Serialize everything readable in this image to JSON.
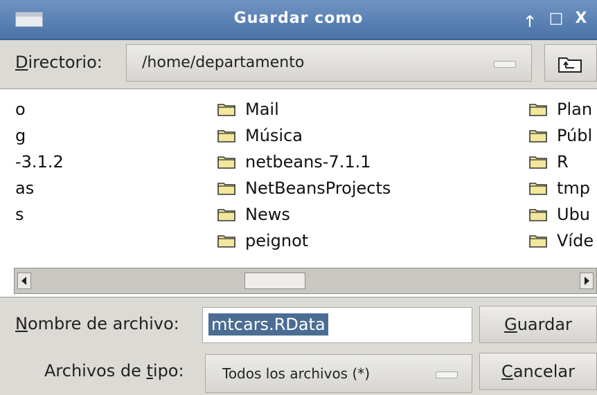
{
  "window": {
    "title": "Guardar como",
    "controls": {
      "shade": "🡑",
      "maximize": "□",
      "close": "X"
    }
  },
  "directory": {
    "label_underlined": "D",
    "label_rest": "irectorio:",
    "path": "/home/departamento",
    "up_button_icon": "folder-up-icon"
  },
  "files": {
    "column1": [
      "o",
      "g",
      "-3.1.2",
      "as",
      "s"
    ],
    "column2": [
      "Mail",
      "Música",
      "netbeans-7.1.1",
      "NetBeansProjects",
      "News",
      "peignot"
    ],
    "column3": [
      "Plan",
      "Públ",
      "R",
      "tmp",
      "Ubu",
      "Víde"
    ]
  },
  "filename": {
    "label_underlined": "N",
    "label_rest": "ombre de archivo:",
    "value": "mtcars.RData"
  },
  "filetype": {
    "label_before": "Archivos de ",
    "label_underlined": "t",
    "label_after": "ipo:",
    "selected": "Todos los archivos (*)"
  },
  "buttons": {
    "save_underlined": "G",
    "save_rest": "uardar",
    "cancel_underlined": "C",
    "cancel_rest": "ancelar"
  },
  "colors": {
    "titlebar": "#4a73a8",
    "selection": "#4b6c93",
    "folder": "#f2e79a"
  }
}
